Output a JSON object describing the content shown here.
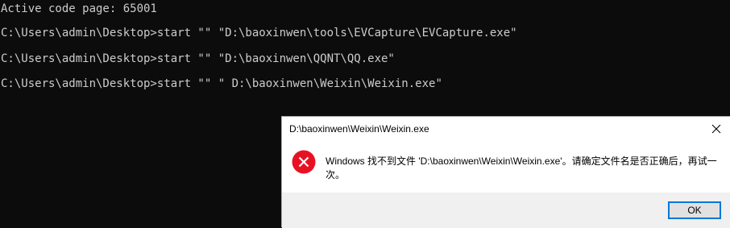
{
  "console": {
    "lines": [
      "Active code page: 65001",
      "C:\\Users\\admin\\Desktop>start \"\" \"D:\\baoxinwen\\tools\\EVCapture\\EVCapture.exe\"",
      "C:\\Users\\admin\\Desktop>start \"\" \"D:\\baoxinwen\\QQNT\\QQ.exe\"",
      "C:\\Users\\admin\\Desktop>start \"\" \" D:\\baoxinwen\\Weixin\\Weixin.exe\""
    ]
  },
  "dialog": {
    "title": "D:\\baoxinwen\\Weixin\\Weixin.exe",
    "message": "Windows 找不到文件 'D:\\baoxinwen\\Weixin\\Weixin.exe'。请确定文件名是否正确后，再试一次。",
    "ok_label": "OK",
    "icon": "error-icon",
    "colors": {
      "icon_red": "#e81123",
      "accent": "#0078d7"
    }
  }
}
